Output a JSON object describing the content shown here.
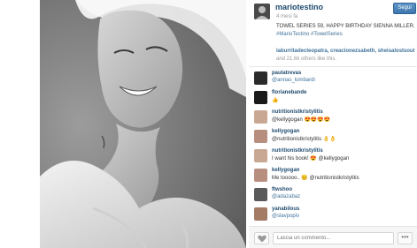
{
  "post": {
    "username": "mariotestino",
    "time_ago": "4 mesi fa",
    "follow_label": "Segui",
    "caption": "TOWEL SERIES 59, HAPPY BIRTHDAY SIENNA MILLER.",
    "hashtags": "#MarioTestino #TowelSeries",
    "likes": {
      "names": "laburritadecleopatra, creacionezsabeth, sheisalostsoul",
      "suffix": "and 21.6k others like this."
    }
  },
  "comments": [
    {
      "user": "paulatrevas",
      "text": "@annas_lombardi",
      "avatar_color": "#2b2b2b"
    },
    {
      "user": "florianebande",
      "text": "👍",
      "avatar_color": "#1a1a1a"
    },
    {
      "user": "nutritionistkristylitis",
      "text": "@kellygogan 😍😍😍😍",
      "avatar_color": "#c9a893"
    },
    {
      "user": "kellygogan",
      "text": "@nutritionistkristylitis 👌👌",
      "avatar_color": "#b88f7e"
    },
    {
      "user": "nutritionistkristylitis",
      "text": "I want his book! 😍 @kellygogan",
      "avatar_color": "#c9a893"
    },
    {
      "user": "kellygogan",
      "text": "Me tooooo.. 😊 @nutritionistkristylitis",
      "avatar_color": "#b88f7e"
    },
    {
      "user": "ftwshoo",
      "text": "@adazabaz",
      "avatar_color": "#5a5a5a"
    },
    {
      "user": "yanabilous",
      "text": "@slavpopiv",
      "avatar_color": "#a47b65"
    }
  ],
  "footer": {
    "comment_placeholder": "Lascia un commento...",
    "more_label": "•••"
  },
  "icons": {
    "like": "heart-icon",
    "more": "ellipsis-icon"
  }
}
